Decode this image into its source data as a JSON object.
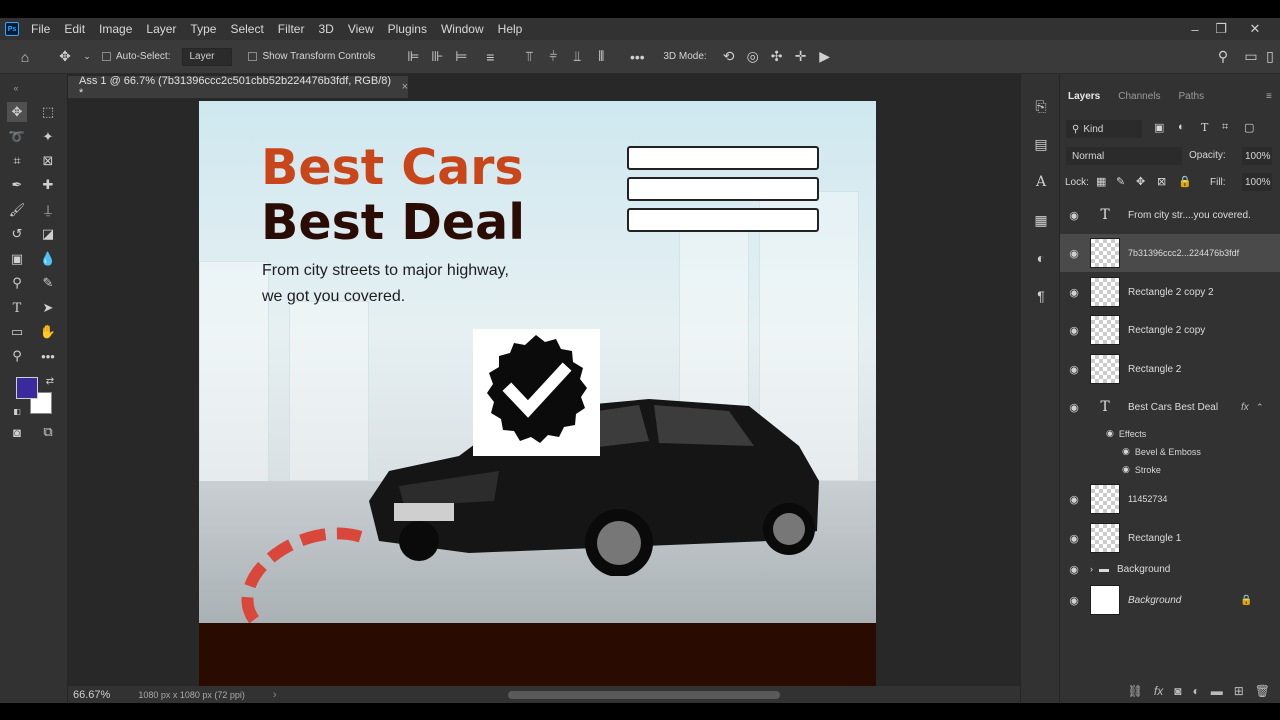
{
  "app": {
    "logo": "Ps",
    "menu": [
      "File",
      "Edit",
      "Image",
      "Layer",
      "Type",
      "Select",
      "Filter",
      "3D",
      "View",
      "Plugins",
      "Window",
      "Help"
    ],
    "window_controls": [
      "–",
      "❐",
      "✕"
    ]
  },
  "options": {
    "auto_select_label": "Auto-Select:",
    "auto_select_value": "Layer",
    "show_transform_label": "Show Transform Controls",
    "three_d_mode_label": "3D Mode:"
  },
  "document": {
    "tab_title": "Ass 1 @ 66.7% (7b31396ccc2c501cbb52b224476b3fdf, RGB/8) *",
    "tab_close": "×",
    "zoom": "66.67%",
    "size_info": "1080 px x 1080 px (72 ppi)"
  },
  "canvas": {
    "headline_1": "Best Cars",
    "headline_2": "Best Deal",
    "subtext_line_1": "From city streets to major highway,",
    "subtext_line_2": "we got you covered."
  },
  "colors": {
    "foreground": "#3a2a9c",
    "background": "#ffffff",
    "accent_orange": "#c9461a",
    "dark_brown": "#2a0c05",
    "footer_brown": "#2a0b02"
  },
  "layers_panel": {
    "tabs": [
      "Layers",
      "Channels",
      "Paths"
    ],
    "kind_label": "Kind",
    "blend_mode": "Normal",
    "opacity_label": "Opacity:",
    "opacity_value": "100%",
    "lock_label": "Lock:",
    "fill_label": "Fill:",
    "fill_value": "100%",
    "layers": [
      {
        "name": "From city str....you covered.",
        "type": "text"
      },
      {
        "name": "7b31396ccc2...224476b3fdf",
        "type": "smart",
        "selected": true
      },
      {
        "name": "Rectangle 2 copy 2",
        "type": "shape"
      },
      {
        "name": "Rectangle 2 copy",
        "type": "shape"
      },
      {
        "name": "Rectangle 2",
        "type": "shape"
      },
      {
        "name": "Best Cars Best Deal",
        "type": "text",
        "fx": "fx"
      },
      {
        "name": "11452734",
        "type": "smart"
      },
      {
        "name": "Rectangle 1",
        "type": "shape"
      },
      {
        "name": "Background",
        "type": "group"
      },
      {
        "name": "Background",
        "type": "background"
      }
    ],
    "effects": {
      "title": "Effects",
      "items": [
        "Bevel & Emboss",
        "Stroke"
      ]
    }
  }
}
